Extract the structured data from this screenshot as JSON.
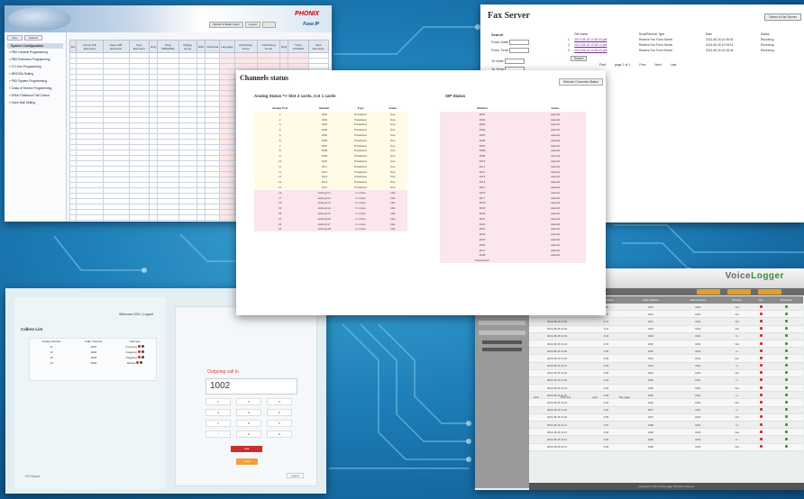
{
  "panel_a": {
    "brand": "PHONIX",
    "product": "Fuse IP",
    "top_buttons": [
      "Restart & Make Clean",
      "Logout"
    ],
    "side_tabs": [
      "Save",
      "Refresh"
    ],
    "side_selected": "System Configuration",
    "side_items": [
      "PBX General Programming",
      "PBX Extension Programming",
      "CO Line Programming",
      "BR/DISA Setting",
      "PBX System Programming",
      "Class of Service Programming",
      "DISA/ Outbound Call Control",
      "Voice Mail Setting"
    ],
    "columns": [
      "Ext",
      "Phone SIP Extension",
      "Name SIP Extension",
      "Type Extension",
      "Ring",
      "Ring MRD/DND",
      "Paging Group",
      "DND",
      "Voicemail",
      "Language",
      "Call Pickup Group",
      "Call Pickup Group",
      "Ring",
      "Trunk ACCESS",
      "Web Extension"
    ]
  },
  "panel_b": {
    "title": "Fax Server",
    "select_label": "Select a Fax Server",
    "search_label": "Search",
    "fields": [
      "From Date",
      "From Time",
      "To Date",
      "To Time"
    ],
    "search_button": "Search",
    "columns": [
      "",
      "File Name",
      "Send/Receive Type",
      "Date",
      "Status"
    ],
    "rows": [
      {
        "n": "1",
        "file": "2013-08-15 10:35:33.pdf",
        "type": "Receive Fax From Server",
        "date": "2013-08-15 10:35:33",
        "status": "Receiving"
      },
      {
        "n": "2",
        "file": "2013-08-15 10:28:14.pdf",
        "type": "Receive Fax From Server",
        "date": "2013-08-15 10:28:14",
        "status": "Receiving"
      },
      {
        "n": "3",
        "file": "2013-08-15 10:18:44.pdf",
        "type": "Receive Fax From Server",
        "date": "2013-08-15 10:18:44",
        "status": "Receiving"
      }
    ],
    "pager": [
      "First",
      "page 1 of 1",
      "Prev",
      "Next",
      "Last"
    ]
  },
  "panel_c": {
    "title": "Channels status",
    "refresh": "Refresh Channels Status",
    "analog_heading": "Analog Status => Slot 2 cards, Cot 1 cards",
    "sip_heading": "SIP Status",
    "analog_columns": [
      "Analog Port",
      "Number",
      "Type",
      "Status"
    ],
    "sip_columns": [
      "Number",
      "Status"
    ],
    "analog_rows": [
      {
        "port": "1",
        "num": "1001",
        "type": "Extension",
        "status": "free"
      },
      {
        "port": "2",
        "num": "1002",
        "type": "Extension",
        "status": "free"
      },
      {
        "port": "3",
        "num": "1003",
        "type": "Extension",
        "status": "free"
      },
      {
        "port": "4",
        "num": "1004",
        "type": "Extension",
        "status": "free"
      },
      {
        "port": "5",
        "num": "1005",
        "type": "Extension",
        "status": "free"
      },
      {
        "port": "6",
        "num": "1006",
        "type": "Extension",
        "status": "free"
      },
      {
        "port": "7",
        "num": "1007",
        "type": "Extension",
        "status": "free"
      },
      {
        "port": "8",
        "num": "1008",
        "type": "Extension",
        "status": "free"
      },
      {
        "port": "9",
        "num": "1009",
        "type": "Extension",
        "status": "free"
      },
      {
        "port": "10",
        "num": "1010",
        "type": "Extension",
        "status": "free"
      },
      {
        "port": "11",
        "num": "1011",
        "type": "Extension",
        "status": "free"
      },
      {
        "port": "12",
        "num": "1012",
        "type": "Extension",
        "status": "free"
      },
      {
        "port": "13",
        "num": "1013",
        "type": "Extension",
        "status": "free"
      },
      {
        "port": "14",
        "num": "1014",
        "type": "Extension",
        "status": "free"
      },
      {
        "port": "15",
        "num": "1015",
        "type": "Extension",
        "status": "free"
      },
      {
        "port": "16",
        "num": "analog1x1",
        "type": "Co Line",
        "status": "idle"
      },
      {
        "port": "17",
        "num": "analog1x2",
        "type": "Co Line",
        "status": "idle"
      },
      {
        "port": "18",
        "num": "analog1x3",
        "type": "Co Line",
        "status": "idle"
      },
      {
        "port": "19",
        "num": "analog1x4",
        "type": "Co Line",
        "status": "idle"
      },
      {
        "port": "20",
        "num": "analog1x5",
        "type": "Co Line",
        "status": "idle"
      },
      {
        "port": "21",
        "num": "analog1x6",
        "type": "Co Line",
        "status": "idle"
      },
      {
        "port": "22",
        "num": "analog1x7",
        "type": "Co Line",
        "status": "idle"
      },
      {
        "port": "23",
        "num": "analog1x8",
        "type": "Co Line",
        "status": "idle"
      }
    ],
    "sip_rows": [
      {
        "num": "2001",
        "status": "unavail"
      },
      {
        "num": "2002",
        "status": "unavail"
      },
      {
        "num": "2003",
        "status": "unavail"
      },
      {
        "num": "2004",
        "status": "unavail"
      },
      {
        "num": "2005",
        "status": "unavail"
      },
      {
        "num": "2006",
        "status": "unavail"
      },
      {
        "num": "2007",
        "status": "unavail"
      },
      {
        "num": "2008",
        "status": "unavail"
      },
      {
        "num": "2009",
        "status": "unavail"
      },
      {
        "num": "2010",
        "status": "unavail"
      },
      {
        "num": "2011",
        "status": "unavail"
      },
      {
        "num": "2012",
        "status": "unavail"
      },
      {
        "num": "2013",
        "status": "unavail"
      },
      {
        "num": "2014",
        "status": "unavail"
      },
      {
        "num": "2015",
        "status": "unavail"
      },
      {
        "num": "2016",
        "status": "unavail"
      },
      {
        "num": "2017",
        "status": "unavail"
      },
      {
        "num": "2018",
        "status": "unavail"
      },
      {
        "num": "2019",
        "status": "unavail"
      },
      {
        "num": "2020",
        "status": "unavail"
      },
      {
        "num": "2021",
        "status": "unavail"
      },
      {
        "num": "2022",
        "status": "unavail"
      },
      {
        "num": "2023",
        "status": "unavail"
      },
      {
        "num": "2024",
        "status": "unavail"
      },
      {
        "num": "2025",
        "status": "unavail"
      },
      {
        "num": "2026",
        "status": "unavail"
      },
      {
        "num": "2027",
        "status": "unavail"
      },
      {
        "num": "2028",
        "status": "unavail"
      },
      {
        "num": "Extension2",
        "status": ""
      }
    ]
  },
  "panel_d": {
    "welcome": "Welcome 1001 | Logout",
    "list_title": "Callers List",
    "columns": [
      "Analog Number",
      "Caller Number",
      "Call type"
    ],
    "rows": [
      {
        "a": "11",
        "b": "1001",
        "c": "Incoming"
      },
      {
        "a": "12",
        "b": "1002",
        "c": "Outgoing"
      },
      {
        "a": "13",
        "b": "1003",
        "c": "Outgoing"
      },
      {
        "a": "14",
        "b": "1004",
        "c": "Missed"
      }
    ],
    "dial_title": "Outgoing call to",
    "number": "1002",
    "keys": [
      "1",
      "2",
      "3",
      "4",
      "5",
      "6",
      "7",
      "8",
      "9",
      "*",
      "0",
      "#"
    ],
    "call_label": "Call",
    "hang_label": "Hang",
    "logout": "Logout",
    "logo": "HTCScore",
    "colors": {
      "red": "#c9302c",
      "orange": "#f0a03a"
    }
  },
  "panel_e": {
    "logo_a": "Voice",
    "logo_b": "Logger",
    "columns": [
      "Date",
      "Call Duration",
      "Caller Number",
      "Called Number",
      "Direction",
      "Play",
      "Download"
    ],
    "rows": [
      {
        "d": "2013-08-15 12:38",
        "t": "0:00",
        "a": "1001",
        "b": "1002",
        "dir": "Out"
      },
      {
        "d": "2013-08-15 12:36",
        "t": "0:03",
        "a": "1001",
        "b": "1002",
        "dir": "Out"
      },
      {
        "d": "2013-08-15 12:35",
        "t": "0:13",
        "a": "1001",
        "b": "1003",
        "dir": "Out"
      },
      {
        "d": "2013-08-15 12:34",
        "t": "0:11",
        "a": "1001",
        "b": "1004",
        "dir": "Out"
      },
      {
        "d": "2013-08-15 12:33",
        "t": "0:02",
        "a": "1002",
        "b": "1001",
        "dir": "In"
      },
      {
        "d": "2013-08-15 12:31",
        "t": "0:07",
        "a": "1002",
        "b": "1003",
        "dir": "Out"
      },
      {
        "d": "2013-08-15 12:30",
        "t": "0:05",
        "a": "1003",
        "b": "1001",
        "dir": "In"
      },
      {
        "d": "2013-08-15 12:29",
        "t": "0:09",
        "a": "1003",
        "b": "1002",
        "dir": "Out"
      },
      {
        "d": "2013-08-15 12:27",
        "t": "0:04",
        "a": "1004",
        "b": "1001",
        "dir": "In"
      },
      {
        "d": "2013-08-15 12:26",
        "t": "0:06",
        "a": "1004",
        "b": "1002",
        "dir": "Out"
      },
      {
        "d": "2013-08-15 12:25",
        "t": "0:12",
        "a": "1005",
        "b": "1001",
        "dir": "In"
      },
      {
        "d": "2013-08-15 12:24",
        "t": "0:03",
        "a": "1005",
        "b": "1003",
        "dir": "Out"
      },
      {
        "d": "2013-08-15 12:22",
        "t": "0:08",
        "a": "1006",
        "b": "1001",
        "dir": "In"
      },
      {
        "d": "2013-08-15 12:21",
        "t": "0:02",
        "a": "1006",
        "b": "1004",
        "dir": "Out"
      },
      {
        "d": "2013-08-15 12:20",
        "t": "0:10",
        "a": "1007",
        "b": "1001",
        "dir": "In"
      },
      {
        "d": "2013-08-15 12:18",
        "t": "0:05",
        "a": "1007",
        "b": "1002",
        "dir": "Out"
      },
      {
        "d": "2013-08-15 12:17",
        "t": "0:07",
        "a": "1008",
        "b": "1001",
        "dir": "In"
      },
      {
        "d": "2013-08-15 12:15",
        "t": "0:04",
        "a": "1008",
        "b": "1003",
        "dir": "Out"
      },
      {
        "d": "2013-08-15 12:14",
        "t": "0:06",
        "a": "1009",
        "b": "1001",
        "dir": "In"
      },
      {
        "d": "2013-08-15 12:12",
        "t": "0:09",
        "a": "1009",
        "b": "1004",
        "dir": "Out"
      }
    ],
    "pager": [
      "First",
      "Prev 1/1",
      "Last",
      "Per page"
    ],
    "footer": "Copyright © 2013 VoiceLogger. All rights reserved.",
    "colors": {
      "play": "#d03030",
      "download": "#3a9a3a",
      "nav": "#e0a030"
    }
  }
}
